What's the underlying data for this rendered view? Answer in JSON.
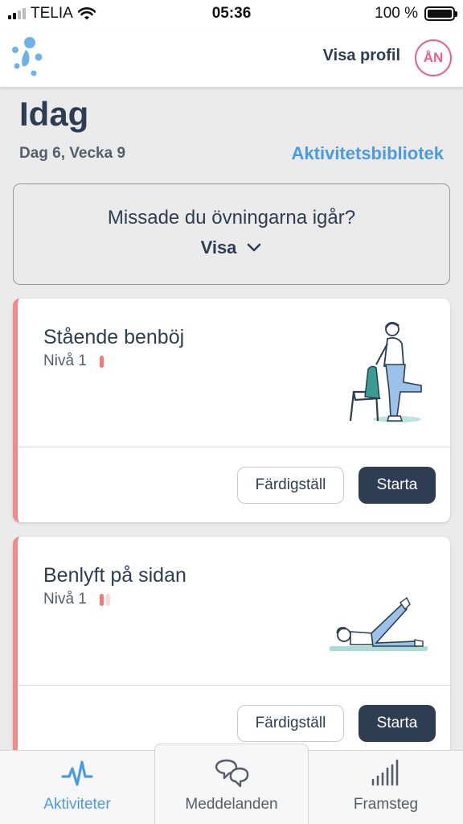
{
  "status_bar": {
    "carrier": "TELIA",
    "time": "05:36",
    "battery": "100 %"
  },
  "header": {
    "profile_link": "Visa profil",
    "avatar_initials": "ÅN"
  },
  "page": {
    "title": "Idag",
    "subtitle": "Dag 6, Vecka 9",
    "library_link": "Aktivitetsbibliotek"
  },
  "missed": {
    "question": "Missade du övningarna igår?",
    "show_label": "Visa"
  },
  "cards": [
    {
      "title": "Stående benböj",
      "level": "Nivå 1",
      "complete_label": "Färdigställ",
      "start_label": "Starta"
    },
    {
      "title": "Benlyft på sidan",
      "level": "Nivå 1",
      "complete_label": "Färdigställ",
      "start_label": "Starta"
    }
  ],
  "tabs": [
    {
      "label": "Aktiviteter",
      "icon": "activity-icon"
    },
    {
      "label": "Meddelanden",
      "icon": "chat-icon"
    },
    {
      "label": "Framsteg",
      "icon": "progress-bars-icon"
    }
  ],
  "colors": {
    "accent": "#4a9be0",
    "primary": "#2f3d52",
    "card_stripe": "#f28a8a",
    "avatar": "#e8608e"
  }
}
